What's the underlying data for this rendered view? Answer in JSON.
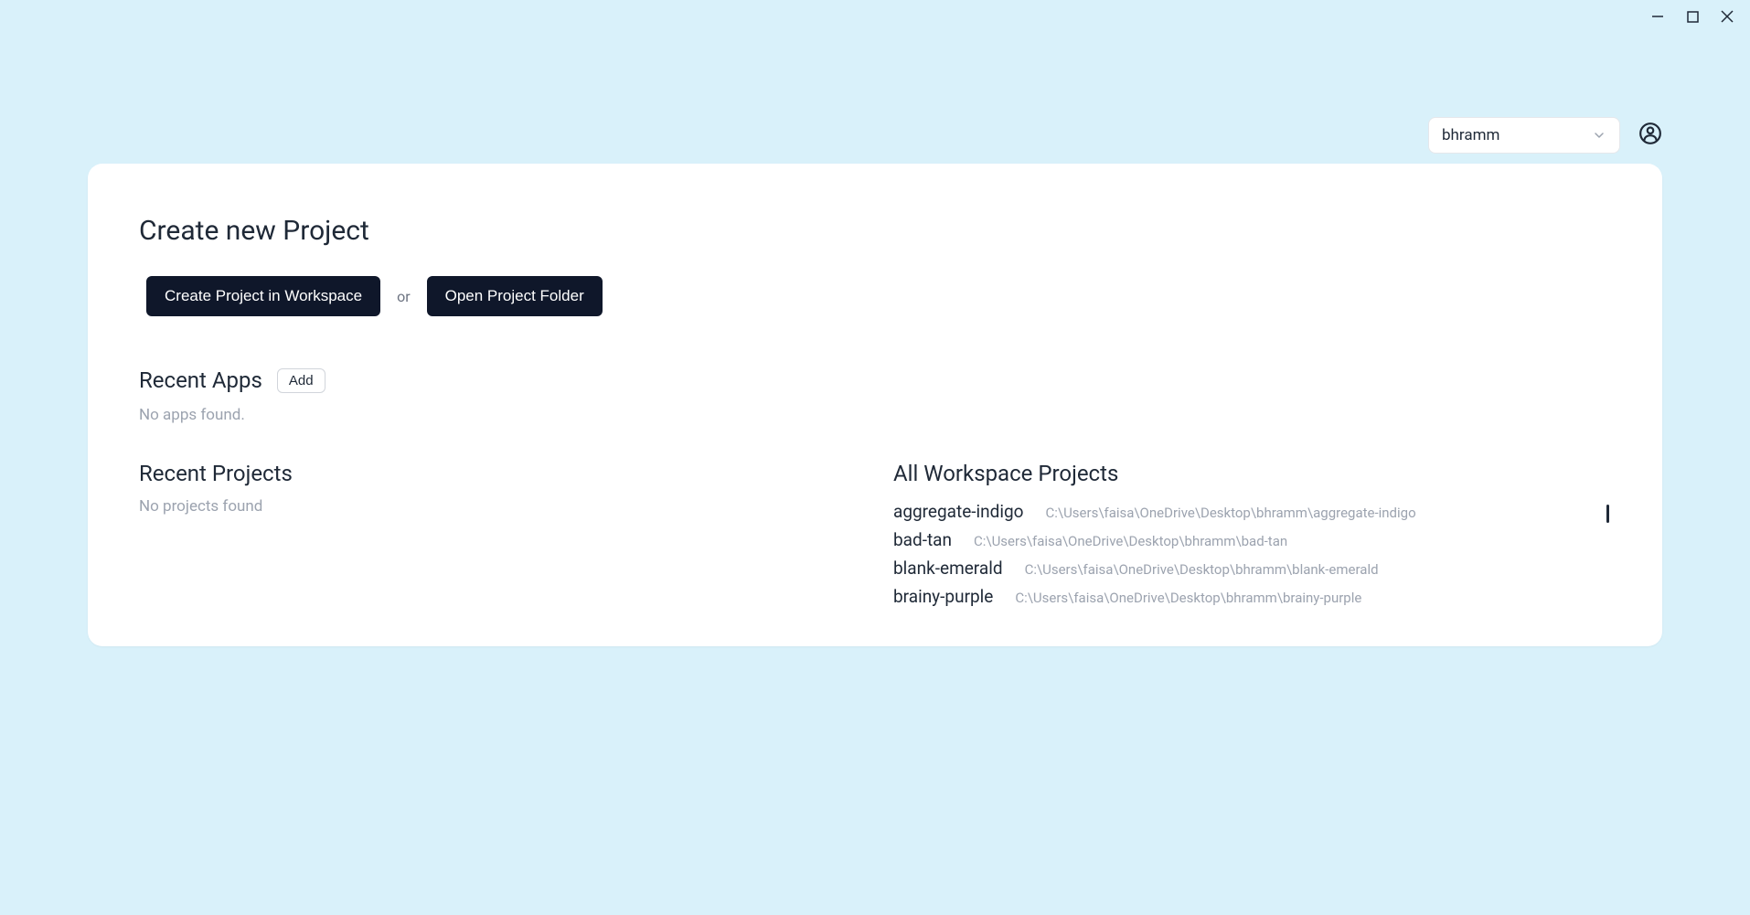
{
  "window": {
    "minimize": "minimize",
    "maximize": "maximize",
    "close": "close"
  },
  "header": {
    "workspace_name": "bhramm"
  },
  "main": {
    "create_title": "Create new Project",
    "create_in_workspace_label": "Create Project in Workspace",
    "or_label": "or",
    "open_folder_label": "Open Project Folder",
    "recent_apps_title": "Recent Apps",
    "add_label": "Add",
    "no_apps_text": "No apps found.",
    "recent_projects_title": "Recent Projects",
    "no_projects_text": "No projects found",
    "all_workspace_projects_title": "All Workspace Projects",
    "workspace_projects": [
      {
        "name": "aggregate-indigo",
        "path": "C:\\Users\\faisa\\OneDrive\\Desktop\\bhramm\\aggregate-indigo"
      },
      {
        "name": "bad-tan",
        "path": "C:\\Users\\faisa\\OneDrive\\Desktop\\bhramm\\bad-tan"
      },
      {
        "name": "blank-emerald",
        "path": "C:\\Users\\faisa\\OneDrive\\Desktop\\bhramm\\blank-emerald"
      },
      {
        "name": "brainy-purple",
        "path": "C:\\Users\\faisa\\OneDrive\\Desktop\\bhramm\\brainy-purple"
      }
    ]
  }
}
